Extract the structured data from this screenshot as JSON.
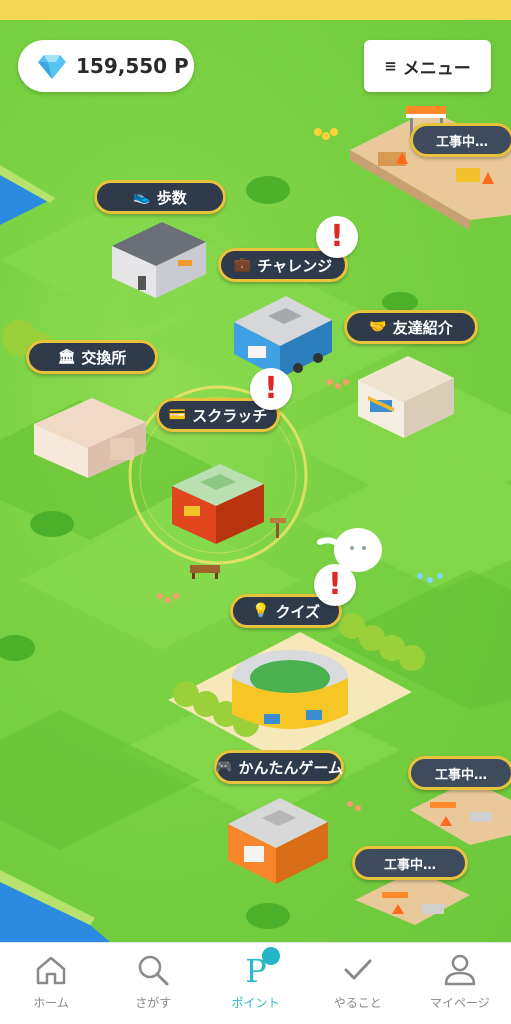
{
  "points": {
    "value": "159,550 P"
  },
  "menu": {
    "label": "メニュー",
    "icon": "hamburger-icon"
  },
  "map": {
    "labels": {
      "steps": "歩数",
      "challenge": "チャレンジ",
      "exchange": "交換所",
      "referral": "友達紹介",
      "scratch": "スクラッチ",
      "quiz": "クイズ",
      "easy_game": "かんたんゲーム",
      "construction_1": "工事中…",
      "construction_2": "工事中…",
      "construction_3": "工事中…"
    },
    "alert_mark": "!"
  },
  "tabs": [
    {
      "label": "ホーム",
      "icon": "home-icon"
    },
    {
      "label": "さがす",
      "icon": "search-icon"
    },
    {
      "label": "ポイント",
      "icon": "point-icon",
      "active": true
    },
    {
      "label": "やること",
      "icon": "check-icon"
    },
    {
      "label": "マイページ",
      "icon": "user-icon"
    }
  ],
  "colors": {
    "accent": "#2bb8c9",
    "label_bg": "#2f3a4a",
    "label_border": "#e7c23a",
    "alert": "#e02626"
  }
}
